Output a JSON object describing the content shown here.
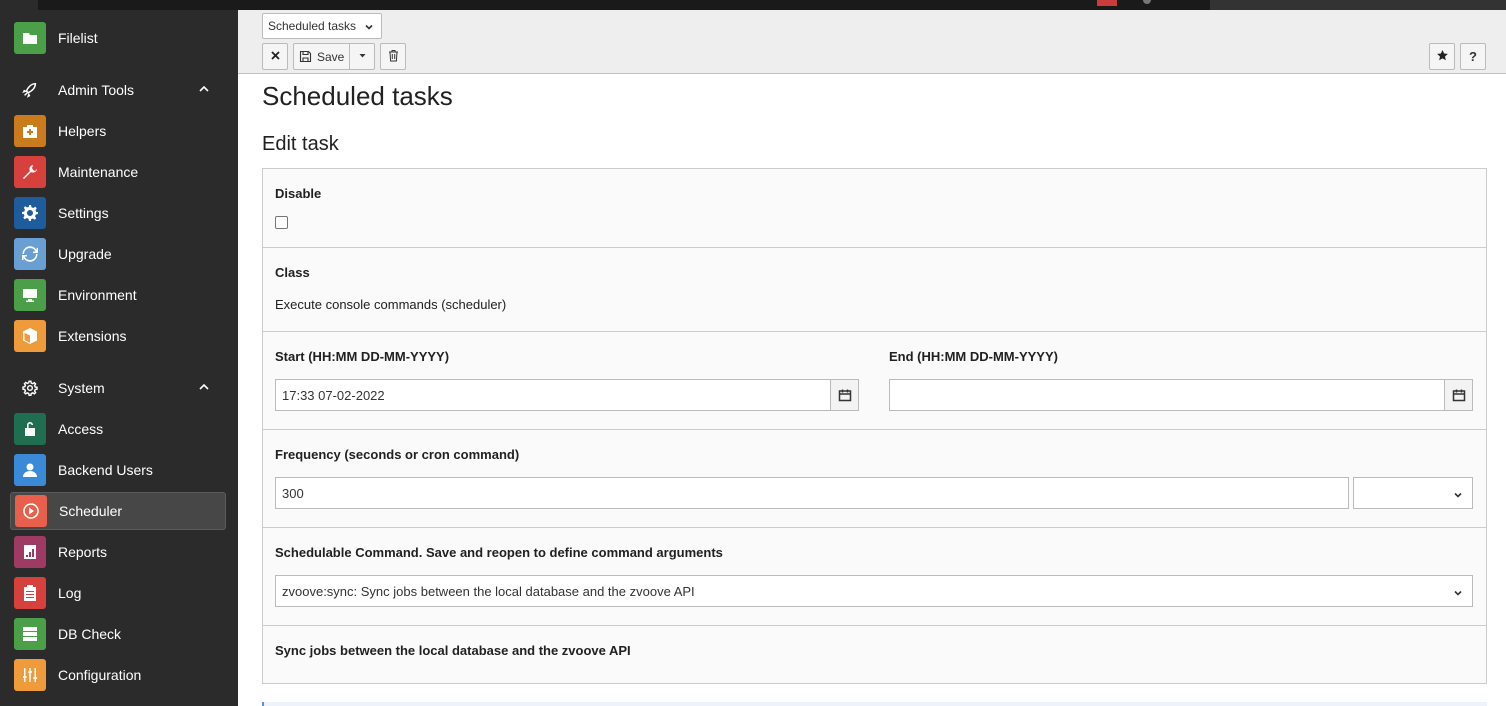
{
  "app": {
    "accent": "#ff8700",
    "sidebar_bg": "#2b2b2b"
  },
  "sidebar": {
    "top_item": {
      "label": "Filelist",
      "icon": "filelist-icon",
      "color": "#4b9f48"
    },
    "groups": [
      {
        "label": "Admin Tools",
        "icon": "rocket-icon",
        "items": [
          {
            "label": "Helpers",
            "icon": "firstaid-icon",
            "color": "#ca7c1d"
          },
          {
            "label": "Maintenance",
            "icon": "wrench-icon",
            "color": "#d6413d"
          },
          {
            "label": "Settings",
            "icon": "gear-icon",
            "color": "#1f5c9c"
          },
          {
            "label": "Upgrade",
            "icon": "refresh-icon",
            "color": "#6a9fd3"
          },
          {
            "label": "Environment",
            "icon": "monitor-icon",
            "color": "#4b9f48"
          },
          {
            "label": "Extensions",
            "icon": "box-icon",
            "color": "#f09b3b"
          }
        ]
      },
      {
        "label": "System",
        "icon": "gear-outline-icon",
        "items": [
          {
            "label": "Access",
            "icon": "unlock-icon",
            "color": "#1e6e4f"
          },
          {
            "label": "Backend Users",
            "icon": "user-icon",
            "color": "#3b8ad8"
          },
          {
            "label": "Scheduler",
            "icon": "play-icon",
            "color": "#e8604b"
          },
          {
            "label": "Reports",
            "icon": "report-icon",
            "color": "#9e3a63"
          },
          {
            "label": "Log",
            "icon": "clipboard-icon",
            "color": "#d6413d"
          },
          {
            "label": "DB Check",
            "icon": "database-icon",
            "color": "#4b9f48"
          },
          {
            "label": "Configuration",
            "icon": "sliders-icon",
            "color": "#f09b3b"
          }
        ]
      }
    ]
  },
  "docheader": {
    "module_select": "Scheduled tasks",
    "close_icon": "close-icon",
    "save_label": "Save",
    "save_icon": "floppy-icon",
    "dropdown_icon": "caret-down-icon",
    "delete_icon": "trash-icon",
    "bookmark_icon": "star-icon",
    "help_label": "?"
  },
  "main": {
    "title": "Scheduled tasks",
    "subtitle": "Edit task",
    "fields": {
      "disable": {
        "label": "Disable",
        "checked": false
      },
      "class": {
        "label": "Class",
        "value": "Execute console commands (scheduler)"
      },
      "start": {
        "label": "Start (HH:MM DD-MM-YYYY)",
        "value": "17:33 07-02-2022"
      },
      "end": {
        "label": "End (HH:MM DD-MM-YYYY)",
        "value": ""
      },
      "frequency": {
        "label": "Frequency (seconds or cron command)",
        "value": "300",
        "select_value": ""
      },
      "command": {
        "label": "Schedulable Command. Save and reopen to define command arguments",
        "value": "zvoove:sync: Sync jobs between the local database and the zvoove API"
      },
      "description": {
        "label": "Sync jobs between the local database and the zvoove API"
      }
    }
  }
}
